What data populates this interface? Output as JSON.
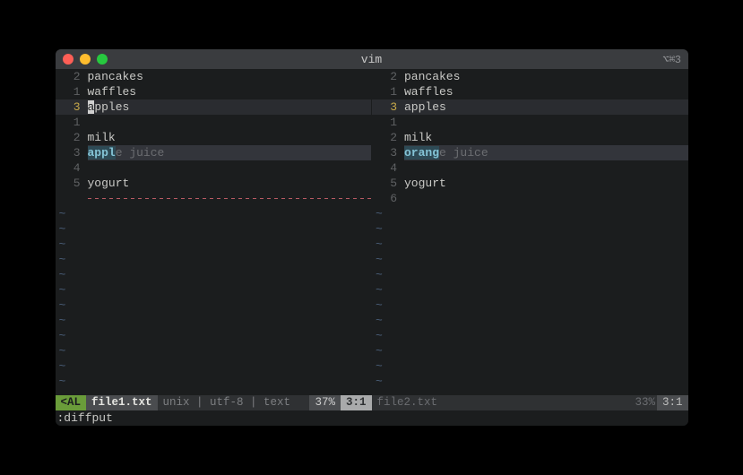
{
  "window": {
    "title": "vim",
    "right_indicator": "⌥⌘3"
  },
  "left": {
    "filename": "file1.txt",
    "lines": [
      {
        "num": "2",
        "text": "pancakes"
      },
      {
        "num": "1",
        "text": "waffles"
      },
      {
        "num": "3",
        "text": "apples",
        "cursor": true,
        "cursor_col": 0
      },
      {
        "num": "1",
        "text": ""
      },
      {
        "num": "2",
        "text": "milk"
      },
      {
        "num": "3",
        "diff": true,
        "chg": "appl",
        "rest": "e juice"
      },
      {
        "num": "4",
        "text": ""
      },
      {
        "num": "5",
        "text": "yogurt"
      },
      {
        "num": "",
        "filler": true
      }
    ],
    "status": {
      "mode": "<AL",
      "filename": "file1.txt",
      "info": "unix | utf-8 | text",
      "percent": "37%",
      "position": "3:1"
    }
  },
  "right": {
    "filename": "file2.txt",
    "lines": [
      {
        "num": "2",
        "text": "pancakes"
      },
      {
        "num": "1",
        "text": "waffles"
      },
      {
        "num": "3",
        "text": "apples",
        "cursor": true
      },
      {
        "num": "1",
        "text": ""
      },
      {
        "num": "2",
        "text": "milk"
      },
      {
        "num": "3",
        "diff": true,
        "chg": "orang",
        "rest": "e juice"
      },
      {
        "num": "4",
        "text": ""
      },
      {
        "num": "5",
        "text": "yogurt"
      },
      {
        "num": "6",
        "text": ""
      }
    ],
    "status": {
      "filename": "file2.txt",
      "percent": "33%",
      "position": "3:1"
    }
  },
  "command": ":diffput",
  "tilde_count": 12
}
